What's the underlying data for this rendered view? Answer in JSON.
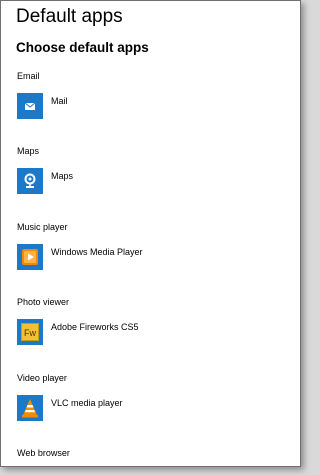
{
  "page": {
    "title": "Default apps",
    "heading": "Choose default apps"
  },
  "categories": [
    {
      "label": "Email",
      "app": "Mail",
      "icon": "mail-icon"
    },
    {
      "label": "Maps",
      "app": "Maps",
      "icon": "maps-icon"
    },
    {
      "label": "Music player",
      "app": "Windows Media Player",
      "icon": "windows-media-player-icon"
    },
    {
      "label": "Photo viewer",
      "app": "Adobe Fireworks CS5",
      "icon": "adobe-fireworks-icon"
    },
    {
      "label": "Video player",
      "app": "VLC media player",
      "icon": "vlc-icon"
    },
    {
      "label": "Web browser"
    }
  ],
  "colors": {
    "tile_blue": "#1e78c8",
    "fireworks_gold": "#c99a1b",
    "vlc_orange": "#f08a00"
  }
}
